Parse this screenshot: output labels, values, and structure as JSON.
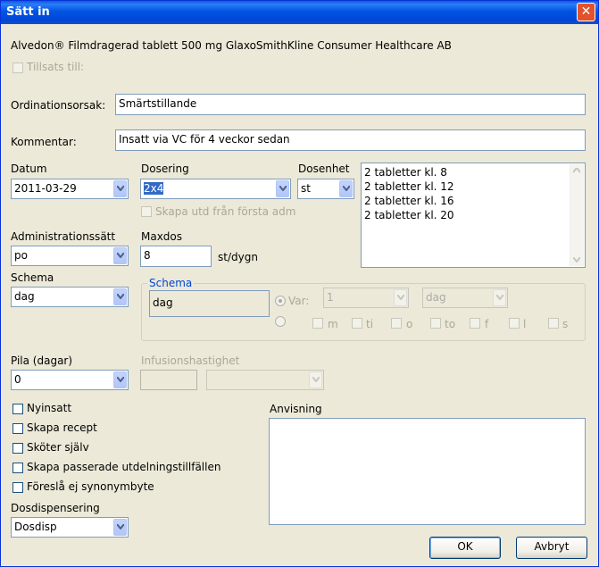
{
  "window": {
    "title": "Sätt in",
    "close": "✕"
  },
  "product": "Alvedon® Filmdragerad tablett 500 mg GlaxoSmithKline Consumer Healthcare AB",
  "tillsats_label": "Tillsats till:",
  "ordinationsorsak": {
    "label": "Ordinationsorsak:",
    "value": "Smärtstillande"
  },
  "kommentar": {
    "label": "Kommentar:",
    "value": "Insatt via VC för 4 veckor sedan"
  },
  "datum": {
    "label": "Datum",
    "value": "2011-03-29"
  },
  "dosering": {
    "label": "Dosering",
    "value": "2x4"
  },
  "dosenhet": {
    "label": "Dosenhet",
    "value": "st"
  },
  "dose_list": [
    "2 tabletter kl. 8",
    "2 tabletter kl. 12",
    "2 tabletter kl. 16",
    "2 tabletter kl. 20"
  ],
  "skapa_utd_label": "Skapa utd från första adm",
  "administrationssatt": {
    "label": "Administrationssätt",
    "value": "po"
  },
  "maxdos": {
    "label": "Maxdos",
    "value": "8",
    "unit": "st/dygn"
  },
  "schema": {
    "label": "Schema",
    "value": "dag"
  },
  "schema_group": {
    "label": "Schema",
    "display": "dag",
    "var_label": "Var:",
    "var_number": "1",
    "var_unit": "dag",
    "days": [
      "m",
      "ti",
      "o",
      "to",
      "f",
      "l",
      "s"
    ]
  },
  "pila": {
    "label": "Pila (dagar)",
    "value": "0"
  },
  "infusionshastighet_label": "Infusionshastighet",
  "checkboxes": [
    "Nyinsatt",
    "Skapa recept",
    "Sköter själv",
    "Skapa passerade utdelningstillfällen",
    "Föreslå ej synonymbyte"
  ],
  "anvisning_label": "Anvisning",
  "dosdispensering": {
    "label": "Dosdispensering",
    "value": "Dosdisp"
  },
  "buttons": {
    "ok": "OK",
    "cancel": "Avbryt"
  }
}
